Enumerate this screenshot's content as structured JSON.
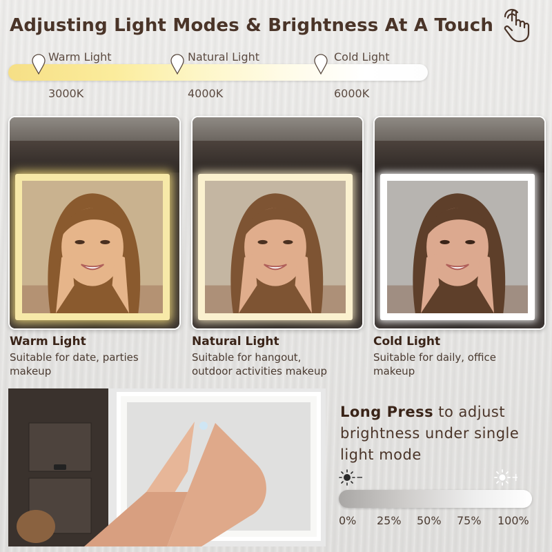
{
  "title": "Adjusting Light Modes & Brightness At A Touch",
  "temperature_scale": {
    "labels": [
      "Warm Light",
      "Natural Light",
      "Cold Light"
    ],
    "kelvins": [
      "3000K",
      "4000K",
      "6000K"
    ]
  },
  "modes": [
    {
      "name": "Warm Light",
      "desc_line1": "Suitable for date, parties",
      "desc_line2": "makeup"
    },
    {
      "name": "Natural Light",
      "desc_line1": "Suitable for hangout,",
      "desc_line2": "outdoor activities makeup"
    },
    {
      "name": "Cold Light",
      "desc_line1": "Suitable for daily, office",
      "desc_line2": "makeup"
    }
  ],
  "long_press": {
    "bold": "Long Press",
    "rest1": "to adjust",
    "line2": "brightness under single",
    "line3": "light mode"
  },
  "brightness": {
    "minus_symbol": "−",
    "plus_symbol": "+",
    "percents": [
      "0%",
      "25%",
      "50%",
      "75%",
      "100%"
    ]
  },
  "colors": {
    "title": "#4a3428",
    "warm": "#f6df86",
    "natural": "#fdf3d0",
    "cold": "#ffffff"
  },
  "icons": [
    "touch-hand-icon",
    "location-pin-icon",
    "sun-dim-icon",
    "sun-bright-icon"
  ]
}
